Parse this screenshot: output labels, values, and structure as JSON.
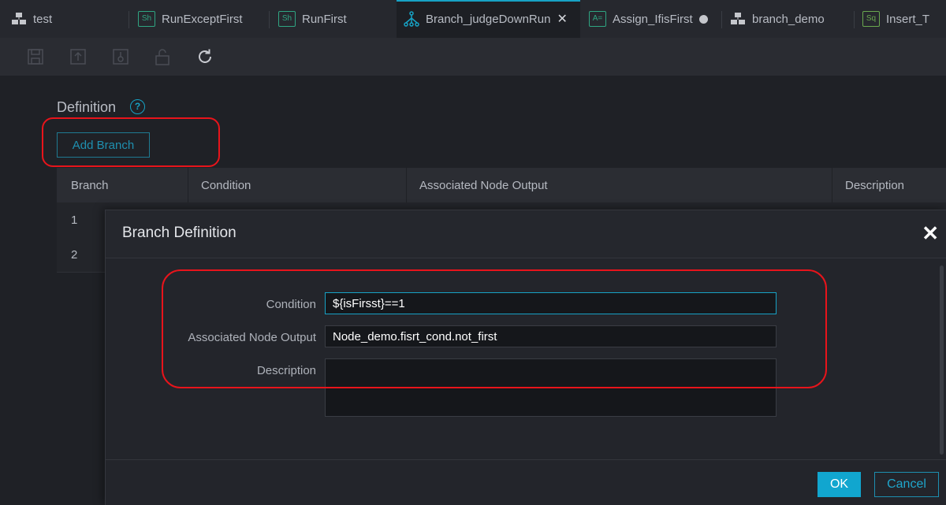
{
  "tabs": [
    {
      "label": "test",
      "icon": "flow-icon"
    },
    {
      "label": "RunExceptFirst",
      "icon": "shell-icon",
      "badge": "Sh"
    },
    {
      "label": "RunFirst",
      "icon": "shell-icon",
      "badge": "Sh"
    },
    {
      "label": "Branch_judgeDownRun",
      "icon": "branch-icon",
      "active": true
    },
    {
      "label": "Assign_IfisFirst",
      "icon": "assign-icon",
      "badge": "A="
    },
    {
      "label": "branch_demo",
      "icon": "flow-icon"
    },
    {
      "label": "Insert_T",
      "icon": "sql-icon",
      "badge": "Sq"
    }
  ],
  "toolbar": [
    "save-icon",
    "submit-icon",
    "publish-icon",
    "lock-icon",
    "refresh-icon"
  ],
  "definition": {
    "title": "Definition",
    "help": "?",
    "add_branch_label": "Add Branch"
  },
  "table": {
    "headers": [
      "Branch",
      "Condition",
      "Associated Node Output",
      "Description"
    ],
    "rows": [
      {
        "branch": "1"
      },
      {
        "branch": "2"
      }
    ]
  },
  "dialog": {
    "title": "Branch Definition",
    "close": "✕",
    "condition_label": "Condition",
    "condition_value": "${isFirsst}==1",
    "node_output_label": "Associated Node Output",
    "node_output_value": "Node_demo.fisrt_cond.not_first",
    "description_label": "Description",
    "description_value": "",
    "ok_label": "OK",
    "cancel_label": "Cancel"
  },
  "colors": {
    "accent": "#17a2c5",
    "highlight": "#e8141b",
    "background": "#1f2126"
  }
}
